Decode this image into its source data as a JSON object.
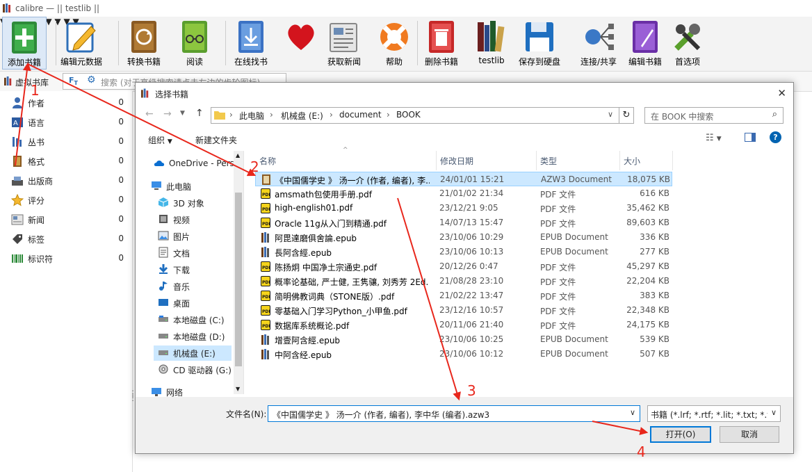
{
  "window": {
    "title": "calibre — || testlib ||"
  },
  "toolbar": {
    "items": [
      {
        "label": "添加书籍",
        "icon": "add-book-icon"
      },
      {
        "label": "编辑元数据",
        "icon": "edit-metadata-icon"
      },
      {
        "label": "转换书籍",
        "icon": "convert-book-icon"
      },
      {
        "label": "阅读",
        "icon": "read-icon"
      },
      {
        "label": "在线找书",
        "icon": "download-icon"
      },
      {
        "label": "",
        "icon": "heart-icon"
      },
      {
        "label": "获取新闻",
        "icon": "news-icon"
      },
      {
        "label": "帮助",
        "icon": "lifebuoy-icon"
      },
      {
        "label": "删除书籍",
        "icon": "trash-icon"
      },
      {
        "label": "testlib",
        "icon": "library-icon"
      },
      {
        "label": "保存到硬盘",
        "icon": "floppy-icon"
      },
      {
        "label": "连接/共享",
        "icon": "network-icon"
      },
      {
        "label": "编辑书籍",
        "icon": "edit-book-icon"
      },
      {
        "label": "首选项",
        "icon": "preferences-icon"
      }
    ]
  },
  "search": {
    "virtual_library": "虚拟书库",
    "placeholder": "搜索 (对于高级搜索请点击左边的齿轮图标)"
  },
  "sidebar": {
    "items": [
      {
        "label": "作者",
        "count": "0"
      },
      {
        "label": "语言",
        "count": "0"
      },
      {
        "label": "丛书",
        "count": "0"
      },
      {
        "label": "格式",
        "count": "0"
      },
      {
        "label": "出版商",
        "count": "0"
      },
      {
        "label": "评分",
        "count": "0"
      },
      {
        "label": "新闻",
        "count": "0"
      },
      {
        "label": "标签",
        "count": "0"
      },
      {
        "label": "标识符",
        "count": "0"
      }
    ]
  },
  "dialog": {
    "title": "选择书籍",
    "address": [
      "此电脑",
      "机械盘 (E:)",
      "document",
      "BOOK"
    ],
    "search_placeholder": "在 BOOK 中搜索",
    "organize": "组织",
    "new_folder": "新建文件夹",
    "nav": [
      {
        "label": "OneDrive - Pers",
        "icon": "cloud-icon"
      },
      {
        "label": "此电脑",
        "icon": "computer-icon"
      },
      {
        "label": "3D 对象",
        "icon": "cube-icon"
      },
      {
        "label": "视频",
        "icon": "video-icon"
      },
      {
        "label": "图片",
        "icon": "picture-icon"
      },
      {
        "label": "文档",
        "icon": "document-icon"
      },
      {
        "label": "下载",
        "icon": "download-arrow-icon"
      },
      {
        "label": "音乐",
        "icon": "music-icon"
      },
      {
        "label": "桌面",
        "icon": "desktop-icon"
      },
      {
        "label": "本地磁盘 (C:)",
        "icon": "drive-icon"
      },
      {
        "label": "本地磁盘 (D:)",
        "icon": "drive-icon"
      },
      {
        "label": "机械盘 (E:)",
        "icon": "drive-icon"
      },
      {
        "label": "CD 驱动器 (G:)",
        "icon": "cd-icon"
      },
      {
        "label": "网络",
        "icon": "network-folder-icon"
      }
    ],
    "columns": {
      "name": "名称",
      "date": "修改日期",
      "type": "类型",
      "size": "大小"
    },
    "files": [
      {
        "name": "《中国儒学史 》 汤一介 (作者, 编者), 李...",
        "date": "24/01/01 15:21",
        "type": "AZW3 Document",
        "size": "18,075 KB",
        "icon": "azw3-icon"
      },
      {
        "name": "amsmath包使用手册.pdf",
        "date": "21/01/02 21:34",
        "type": "PDF 文件",
        "size": "616 KB",
        "icon": "pdf-icon"
      },
      {
        "name": "high-english01.pdf",
        "date": "23/12/21 9:05",
        "type": "PDF 文件",
        "size": "35,462 KB",
        "icon": "pdf-icon"
      },
      {
        "name": "Oracle 11g从入门到精通.pdf",
        "date": "14/07/13 15:47",
        "type": "PDF 文件",
        "size": "89,603 KB",
        "icon": "pdf-icon"
      },
      {
        "name": "阿毘達磨俱舍論.epub",
        "date": "23/10/06 10:29",
        "type": "EPUB Document",
        "size": "336 KB",
        "icon": "epub-icon"
      },
      {
        "name": "長阿含經.epub",
        "date": "23/10/06 10:13",
        "type": "EPUB Document",
        "size": "277 KB",
        "icon": "epub-icon"
      },
      {
        "name": "陈扬炯 中国净土宗通史.pdf",
        "date": "20/12/26 0:47",
        "type": "PDF 文件",
        "size": "45,297 KB",
        "icon": "pdf-icon"
      },
      {
        "name": "概率论基础, 严士健, 王隽骧, 刘秀芳 2Ed...",
        "date": "21/08/28 23:10",
        "type": "PDF 文件",
        "size": "22,204 KB",
        "icon": "pdf-icon"
      },
      {
        "name": "简明佛教词典（STONE版）.pdf",
        "date": "21/02/22 13:47",
        "type": "PDF 文件",
        "size": "383 KB",
        "icon": "pdf-icon"
      },
      {
        "name": "零基础入门学习Python_小甲鱼.pdf",
        "date": "23/12/16 10:57",
        "type": "PDF 文件",
        "size": "22,348 KB",
        "icon": "pdf-icon"
      },
      {
        "name": "数据库系统概论.pdf",
        "date": "20/11/06 21:40",
        "type": "PDF 文件",
        "size": "24,175 KB",
        "icon": "pdf-icon"
      },
      {
        "name": "增壹阿含經.epub",
        "date": "23/10/06 10:25",
        "type": "EPUB Document",
        "size": "539 KB",
        "icon": "epub-icon"
      },
      {
        "name": "中阿含经.epub",
        "date": "23/10/06 10:12",
        "type": "EPUB Document",
        "size": "507 KB",
        "icon": "epub-icon"
      }
    ],
    "filename_label": "文件名(N):",
    "filename_value": "《中国儒学史 》 汤一介 (作者, 编者), 李中华 (编者).azw3",
    "filter_value": "书籍 (*.lrf; *.rtf; *.lit; *.txt; *.txt",
    "open_label": "打开(O)",
    "cancel_label": "取消"
  },
  "annotations": {
    "step1": "1",
    "step2": "2",
    "step3": "3",
    "step4": "4",
    "color": "#e8271c"
  }
}
